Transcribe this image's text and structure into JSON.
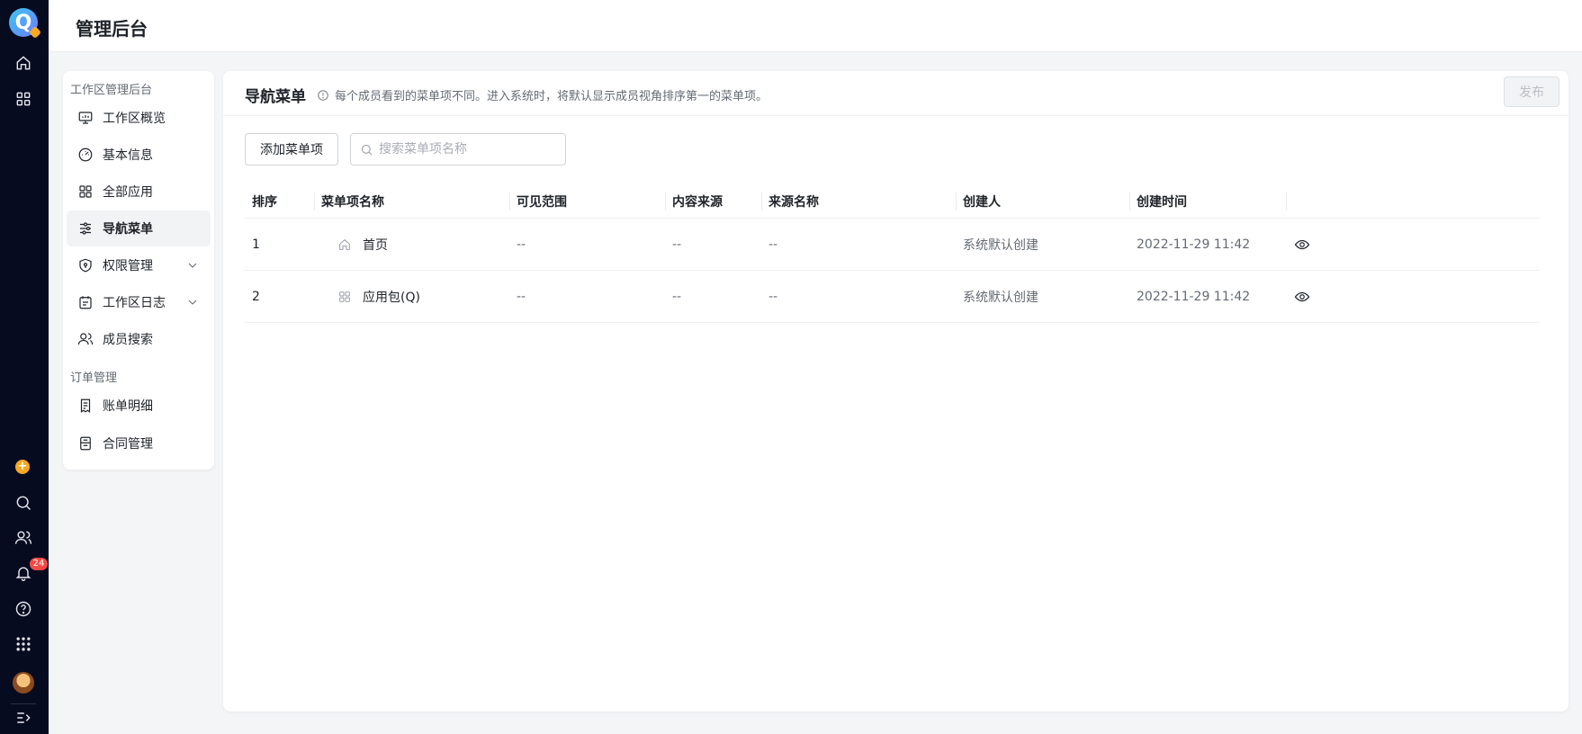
{
  "header": {
    "title": "管理后台"
  },
  "rail": {
    "logo_letter": "Q",
    "notification_count": "24",
    "plus_symbol": "+"
  },
  "sidebar": {
    "group1_title": "工作区管理后台",
    "group2_title": "订单管理",
    "items": [
      {
        "label": "工作区概览",
        "icon": "monitor-icon"
      },
      {
        "label": "基本信息",
        "icon": "gauge-icon"
      },
      {
        "label": "全部应用",
        "icon": "grid-icon"
      },
      {
        "label": "导航菜单",
        "icon": "sliders-icon",
        "active": true
      },
      {
        "label": "权限管理",
        "icon": "shield-icon",
        "expandable": true
      },
      {
        "label": "工作区日志",
        "icon": "calendar-icon",
        "expandable": true
      },
      {
        "label": "成员搜索",
        "icon": "users-icon"
      },
      {
        "label": "账单明细",
        "icon": "receipt-icon"
      },
      {
        "label": "合同管理",
        "icon": "contract-icon"
      }
    ]
  },
  "panel": {
    "title": "导航菜单",
    "tip": "每个成员看到的菜单项不同。进入系统时，将默认显示成员视角排序第一的菜单项。",
    "publish_label": "发布",
    "add_label": "添加菜单项",
    "search_placeholder": "搜索菜单项名称"
  },
  "table": {
    "columns": [
      "排序",
      "菜单项名称",
      "可见范围",
      "内容来源",
      "来源名称",
      "创建人",
      "创建时间"
    ],
    "rows": [
      {
        "order": "1",
        "icon": "home-icon",
        "name": "首页",
        "visibility": "--",
        "source": "--",
        "source_name": "--",
        "creator": "系统默认创建",
        "created_at": "2022-11-29 11:42"
      },
      {
        "order": "2",
        "icon": "grid-icon",
        "name": "应用包(Q)",
        "visibility": "--",
        "source": "--",
        "source_name": "--",
        "creator": "系统默认创建",
        "created_at": "2022-11-29 11:42"
      }
    ]
  },
  "colors": {
    "rail_bg": "#070b1f",
    "accent_orange": "#f6a821",
    "badge_red": "#f54a45",
    "active_item_bg": "#f2f3f5"
  }
}
